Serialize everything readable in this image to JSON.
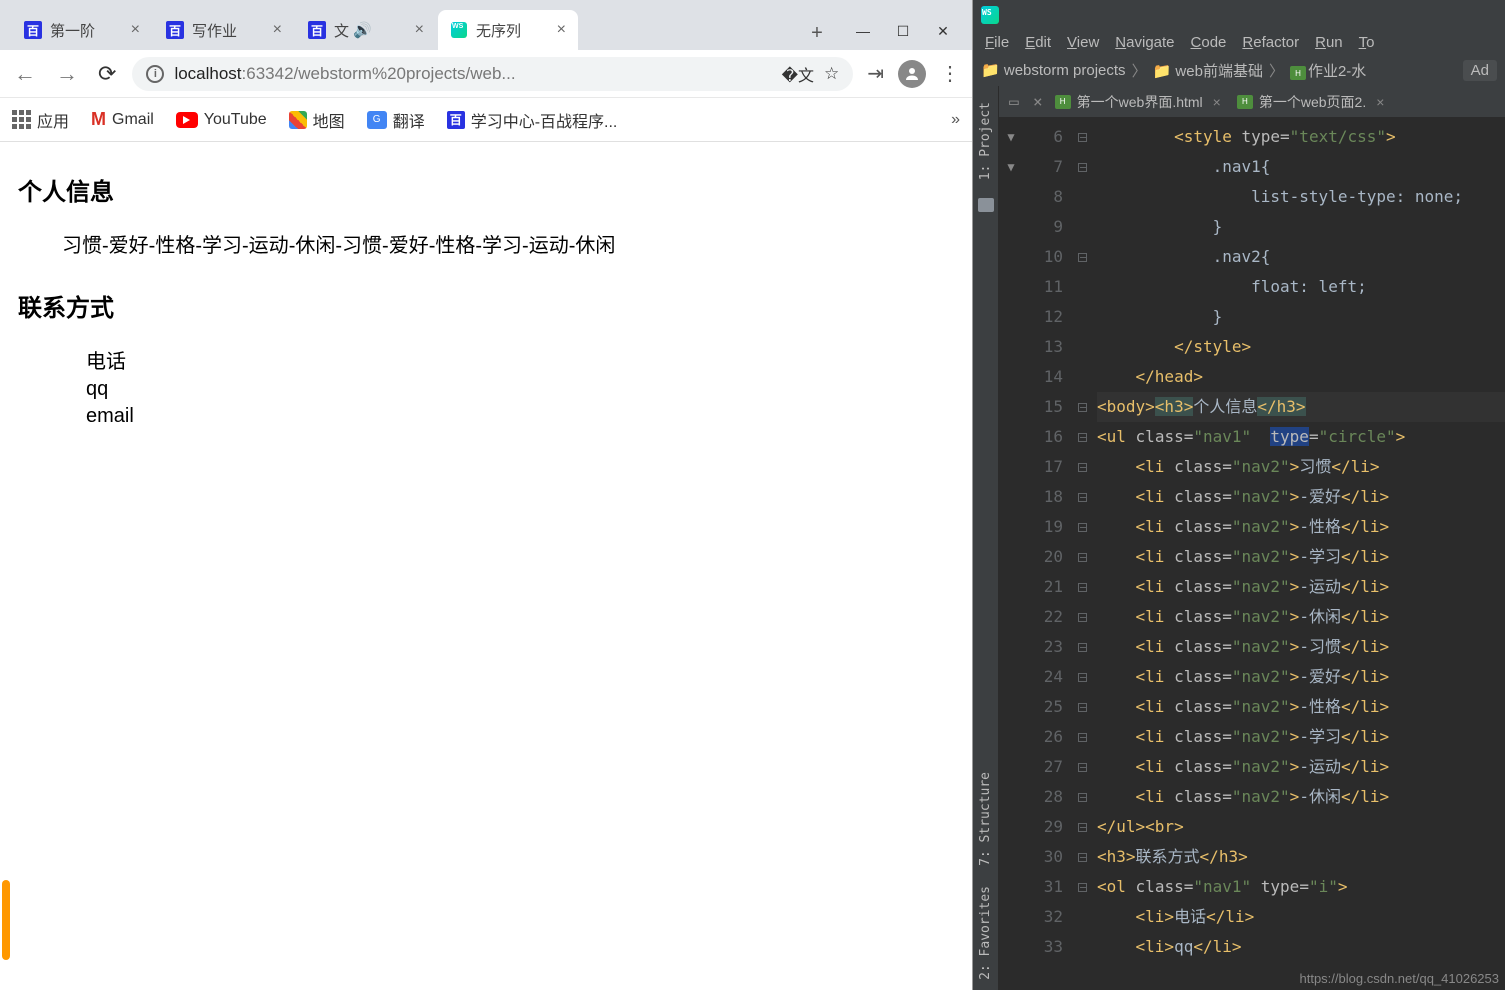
{
  "browser": {
    "tabs": [
      {
        "title": "第一阶",
        "favicon": "baidu"
      },
      {
        "title": "写作业",
        "favicon": "baidu"
      },
      {
        "title": "文",
        "favicon": "baidu",
        "audio": true
      },
      {
        "title": "无序列",
        "favicon": "ws",
        "active": true
      }
    ],
    "url_host": "localhost",
    "url_rest": ":63342/webstorm%20projects/web...",
    "bookmarks": {
      "apps": "应用",
      "gmail": "Gmail",
      "youtube": "YouTube",
      "maps": "地图",
      "translate": "翻译",
      "study": "学习中心-百战程序..."
    }
  },
  "page": {
    "h1": "个人信息",
    "nav_items": [
      "习惯",
      "-爱好",
      "-性格",
      "-学习",
      "-运动",
      "-休闲",
      "-习惯",
      "-爱好",
      "-性格",
      "-学习",
      "-运动",
      "-休闲"
    ],
    "h2": "联系方式",
    "ol_items": [
      "电话",
      "qq",
      "email"
    ]
  },
  "ide": {
    "menu": [
      "File",
      "Edit",
      "View",
      "Navigate",
      "Code",
      "Refactor",
      "Run",
      "To"
    ],
    "breadcrumbs": [
      "webstorm projects",
      "web前端基础",
      "作业2-水"
    ],
    "add_button": "Ad",
    "sidebar": {
      "project": "1: Project",
      "structure": "7: Structure",
      "favorites": "2: Favorites"
    },
    "file_tabs": [
      "第一个web界面.html",
      "第一个web页面2."
    ],
    "line_start": 6,
    "code_lines": [
      {
        "n": 6,
        "html": "        <span class='tag'>&lt;style</span> <span class='attr'>type=</span><span class='str'>\"text/css\"</span><span class='tag'>&gt;</span>"
      },
      {
        "n": 7,
        "html": "            <span class='txt'>.nav1{</span>"
      },
      {
        "n": 8,
        "html": "                <span class='txt'>list-style-type: none;</span>"
      },
      {
        "n": 9,
        "html": "            <span class='txt'>}</span>"
      },
      {
        "n": 10,
        "html": "            <span class='txt'>.nav2{</span>"
      },
      {
        "n": 11,
        "html": "                <span class='txt'>float: left;</span>"
      },
      {
        "n": 12,
        "html": "            <span class='txt'>}</span>"
      },
      {
        "n": 13,
        "html": "        <span class='tag'>&lt;/style&gt;</span>"
      },
      {
        "n": 14,
        "html": "    <span class='tag'>&lt;/head&gt;</span>"
      },
      {
        "n": 15,
        "html": "<span class='tag'>&lt;body&gt;</span><span class='sel'><span class='tag'>&lt;h3&gt;</span></span><span class='txt'>个人信息</span><span class='sel'><span class='tag'>&lt;/h3&gt;</span></span>",
        "current": true
      },
      {
        "n": 16,
        "html": "<span class='tag'>&lt;ul</span> <span class='attr'>class=</span><span class='str'>\"nav1\"</span>  <span class='hl'><span class='attr'>type</span></span><span class='attr'>=</span><span class='str'>\"circle\"</span><span class='tag'>&gt;</span>"
      },
      {
        "n": 17,
        "html": "    <span class='tag'>&lt;li</span> <span class='attr'>class=</span><span class='str'>\"nav2\"</span><span class='tag'>&gt;</span><span class='txt'>习惯</span><span class='tag'>&lt;/li&gt;</span>"
      },
      {
        "n": 18,
        "html": "    <span class='tag'>&lt;li</span> <span class='attr'>class=</span><span class='str'>\"nav2\"</span><span class='tag'>&gt;</span><span class='txt'>-爱好</span><span class='tag'>&lt;/li&gt;</span>"
      },
      {
        "n": 19,
        "html": "    <span class='tag'>&lt;li</span> <span class='attr'>class=</span><span class='str'>\"nav2\"</span><span class='tag'>&gt;</span><span class='txt'>-性格</span><span class='tag'>&lt;/li&gt;</span>"
      },
      {
        "n": 20,
        "html": "    <span class='tag'>&lt;li</span> <span class='attr'>class=</span><span class='str'>\"nav2\"</span><span class='tag'>&gt;</span><span class='txt'>-学习</span><span class='tag'>&lt;/li&gt;</span>",
        "marked": true
      },
      {
        "n": 21,
        "html": "    <span class='tag'>&lt;li</span> <span class='attr'>class=</span><span class='str'>\"nav2\"</span><span class='tag'>&gt;</span><span class='txt'>-运动</span><span class='tag'>&lt;/li&gt;</span>"
      },
      {
        "n": 22,
        "html": "    <span class='tag'>&lt;li</span> <span class='attr'>class=</span><span class='str'>\"nav2\"</span><span class='tag'>&gt;</span><span class='txt'>-休闲</span><span class='tag'>&lt;/li&gt;</span>"
      },
      {
        "n": 23,
        "html": "    <span class='tag'>&lt;li</span> <span class='attr'>class=</span><span class='str'>\"nav2\"</span><span class='tag'>&gt;</span><span class='txt'>-习惯</span><span class='tag'>&lt;/li&gt;</span>"
      },
      {
        "n": 24,
        "html": "    <span class='tag'>&lt;li</span> <span class='attr'>class=</span><span class='str'>\"nav2\"</span><span class='tag'>&gt;</span><span class='txt'>-爱好</span><span class='tag'>&lt;/li&gt;</span>"
      },
      {
        "n": 25,
        "html": "    <span class='tag'>&lt;li</span> <span class='attr'>class=</span><span class='str'>\"nav2\"</span><span class='tag'>&gt;</span><span class='txt'>-性格</span><span class='tag'>&lt;/li&gt;</span>"
      },
      {
        "n": 26,
        "html": "    <span class='tag'>&lt;li</span> <span class='attr'>class=</span><span class='str'>\"nav2\"</span><span class='tag'>&gt;</span><span class='txt'>-学习</span><span class='tag'>&lt;/li&gt;</span>"
      },
      {
        "n": 27,
        "html": "    <span class='tag'>&lt;li</span> <span class='attr'>class=</span><span class='str'>\"nav2\"</span><span class='tag'>&gt;</span><span class='txt'>-运动</span><span class='tag'>&lt;/li&gt;</span>"
      },
      {
        "n": 28,
        "html": "    <span class='tag'>&lt;li</span> <span class='attr'>class=</span><span class='str'>\"nav2\"</span><span class='tag'>&gt;</span><span class='txt'>-休闲</span><span class='tag'>&lt;/li&gt;</span>"
      },
      {
        "n": 29,
        "html": "<span class='tag'>&lt;/ul&gt;&lt;br&gt;</span>"
      },
      {
        "n": 30,
        "html": "<span class='tag'>&lt;h3&gt;</span><span class='txt'>联系方式</span><span class='tag'>&lt;/h3&gt;</span>"
      },
      {
        "n": 31,
        "html": "<span class='tag'>&lt;ol</span> <span class='attr'>class=</span><span class='str'>\"nav1\"</span> <span class='attr'>type=</span><span class='str'>\"i\"</span><span class='tag'>&gt;</span>"
      },
      {
        "n": 32,
        "html": "    <span class='tag'>&lt;li&gt;</span><span class='txt'>电话</span><span class='tag'>&lt;/li&gt;</span>"
      },
      {
        "n": 33,
        "html": "    <span class='tag'>&lt;li&gt;</span><span class='txt'>qq</span><span class='tag'>&lt;/li&gt;</span>"
      }
    ],
    "footer_url": "https://blog.csdn.net/qq_41026253"
  }
}
